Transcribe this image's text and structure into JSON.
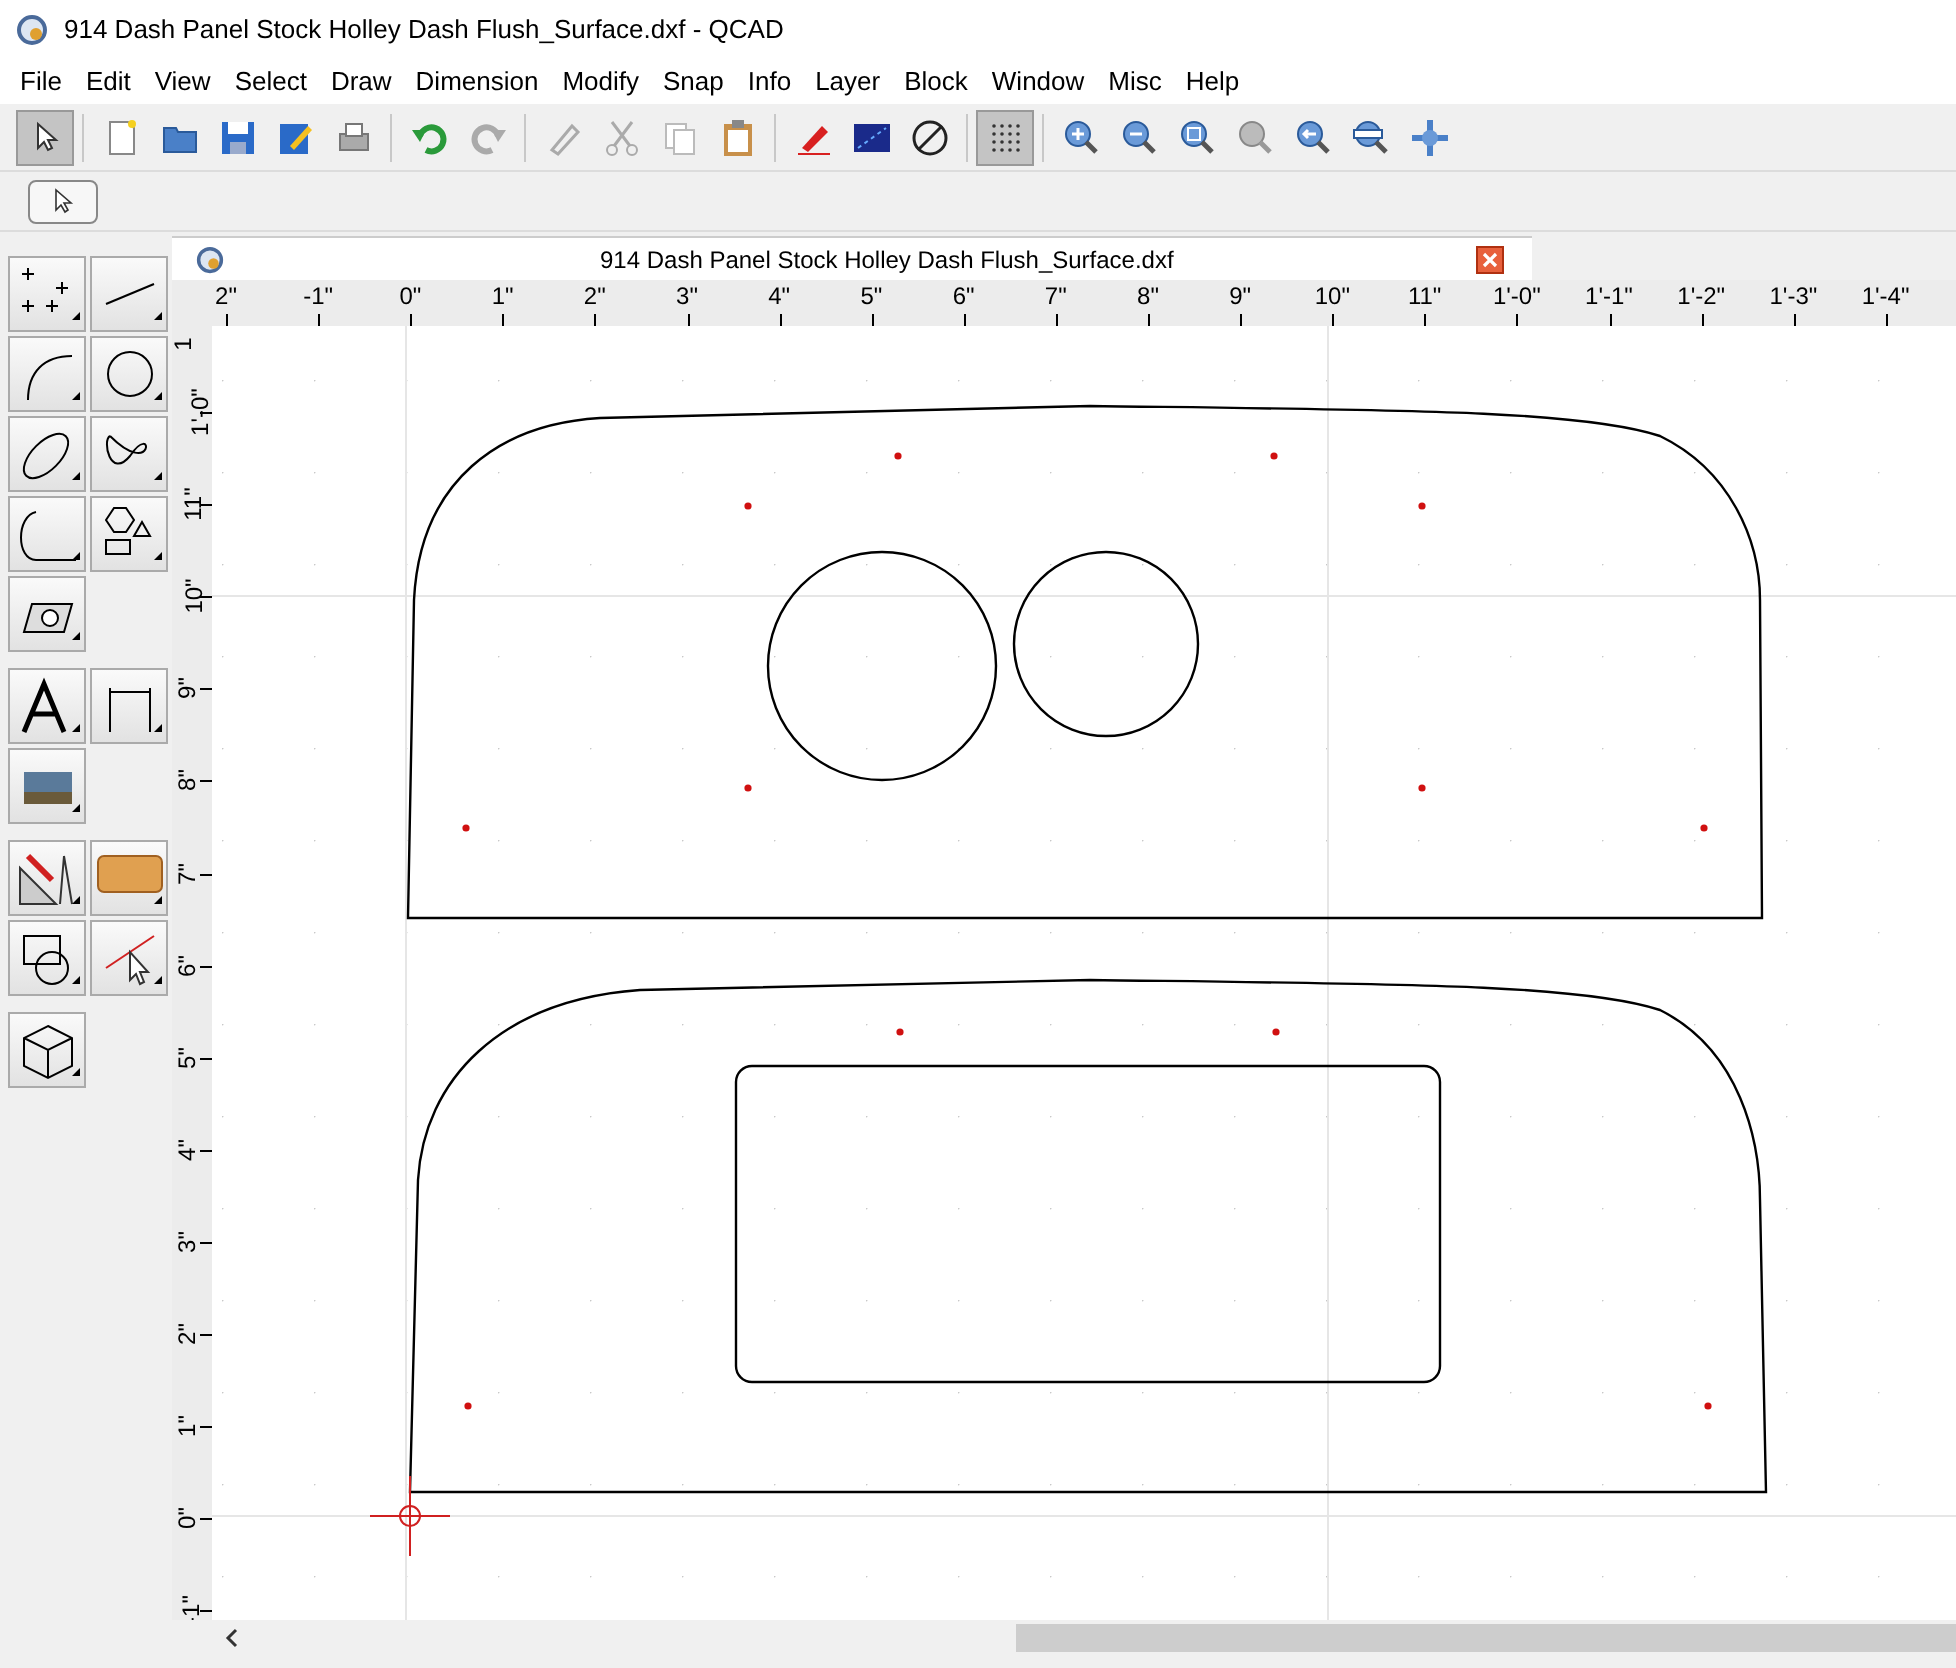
{
  "window": {
    "title": "914 Dash Panel Stock Holley Dash Flush_Surface.dxf - QCAD"
  },
  "menu": [
    "File",
    "Edit",
    "View",
    "Select",
    "Draw",
    "Dimension",
    "Modify",
    "Snap",
    "Info",
    "Layer",
    "Block",
    "Window",
    "Misc",
    "Help"
  ],
  "document_tab": {
    "title": "914 Dash Panel Stock Holley Dash Flush_Surface.dxf"
  },
  "horizontal_ruler": [
    "2\"",
    "-1\"",
    "0\"",
    "1\"",
    "2\"",
    "3\"",
    "4\"",
    "5\"",
    "6\"",
    "7\"",
    "8\"",
    "9\"",
    "10\"",
    "11\"",
    "1'-0\"",
    "1'-1\"",
    "1'-2\"",
    "1'-3\"",
    "1'-4\""
  ],
  "vertical_ruler": [
    "1",
    "1'-0\"",
    "11\"",
    "10\"",
    "9\"",
    "8\"",
    "7\"",
    "6\"",
    "5\"",
    "4\"",
    "3\"",
    "2\"",
    "1\"",
    "0\"",
    "-1\""
  ]
}
